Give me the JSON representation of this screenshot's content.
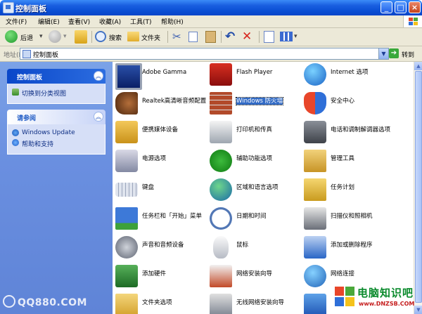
{
  "window": {
    "title": "控制面板"
  },
  "menu": [
    "文件(F)",
    "编辑(E)",
    "查看(V)",
    "收藏(A)",
    "工具(T)",
    "帮助(H)"
  ],
  "toolbar": {
    "back": "后退",
    "search": "搜索",
    "folders": "文件夹"
  },
  "address": {
    "label": "地址(D)",
    "value": "控制面板",
    "go": "转到"
  },
  "sidebar": {
    "panel1": {
      "title": "控制面板",
      "items": [
        "切换到分类视图"
      ]
    },
    "panel2": {
      "title": "请参阅",
      "items": [
        "Windows Update",
        "帮助和支持"
      ]
    }
  },
  "items": [
    {
      "label": "Adobe Gamma",
      "icon": "monitor-icon"
    },
    {
      "label": "Flash Player",
      "icon": "flash-icon"
    },
    {
      "label": "Internet 选项",
      "icon": "globe-settings-icon"
    },
    {
      "label": "Realtek高清晰音频配置",
      "icon": "speaker-icon"
    },
    {
      "label": "Windows 防火墙",
      "icon": "firewall-icon",
      "selected": true
    },
    {
      "label": "安全中心",
      "icon": "shield-icon"
    },
    {
      "label": "便携媒体设备",
      "icon": "media-device-icon"
    },
    {
      "label": "打印机和传真",
      "icon": "printer-icon"
    },
    {
      "label": "电话和调制解调器选项",
      "icon": "phone-icon"
    },
    {
      "label": "电源选项",
      "icon": "power-icon"
    },
    {
      "label": "辅助功能选项",
      "icon": "accessibility-icon"
    },
    {
      "label": "管理工具",
      "icon": "admin-tools-icon"
    },
    {
      "label": "键盘",
      "icon": "keyboard-icon"
    },
    {
      "label": "区域和语言选项",
      "icon": "globe-icon"
    },
    {
      "label": "任务计划",
      "icon": "scheduled-tasks-icon"
    },
    {
      "label": "任务栏和「开始」菜单",
      "icon": "taskbar-icon"
    },
    {
      "label": "日期和时间",
      "icon": "clock-icon"
    },
    {
      "label": "扫描仪和照相机",
      "icon": "scanner-icon"
    },
    {
      "label": "声音和音频设备",
      "icon": "sound-icon"
    },
    {
      "label": "鼠标",
      "icon": "mouse-icon"
    },
    {
      "label": "添加或删除程序",
      "icon": "add-remove-icon"
    },
    {
      "label": "添加硬件",
      "icon": "hardware-icon"
    },
    {
      "label": "网络安装向导",
      "icon": "network-house-icon"
    },
    {
      "label": "网络连接",
      "icon": "network-globe-icon"
    },
    {
      "label": "文件夹选项",
      "icon": "folder-options-icon"
    },
    {
      "label": "无线网络安装向导",
      "icon": "wireless-icon"
    },
    {
      "label": "",
      "icon": "user-accounts-icon"
    }
  ],
  "watermarks": {
    "left": "QQ880.COM",
    "right_cn": "电脑知识吧",
    "right_url": "www.DNZSB.COM"
  }
}
